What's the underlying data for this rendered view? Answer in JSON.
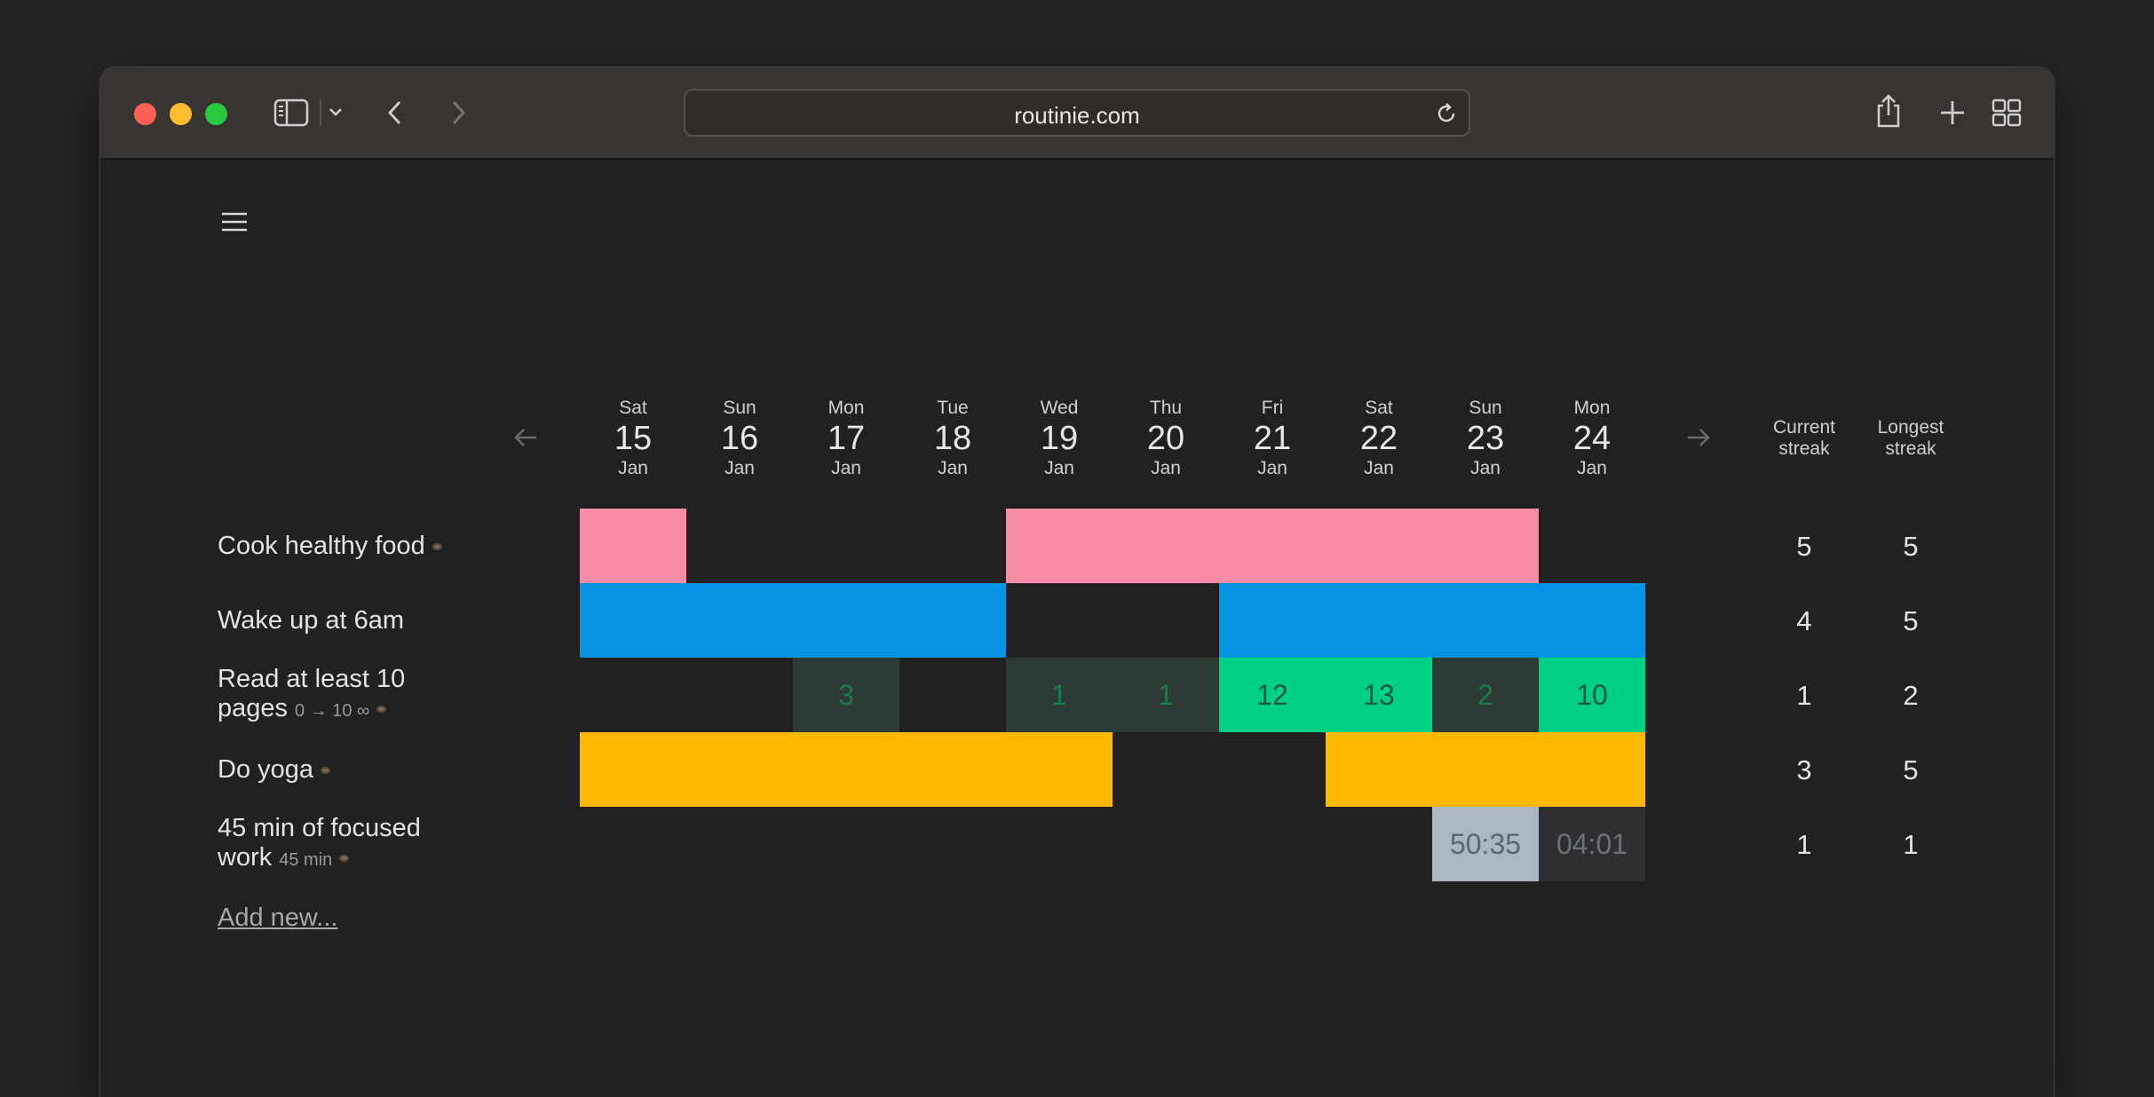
{
  "browser": {
    "url": "routinie.com"
  },
  "days": [
    {
      "dow": "Sat",
      "num": "15",
      "mon": "Jan"
    },
    {
      "dow": "Sun",
      "num": "16",
      "mon": "Jan"
    },
    {
      "dow": "Mon",
      "num": "17",
      "mon": "Jan"
    },
    {
      "dow": "Tue",
      "num": "18",
      "mon": "Jan"
    },
    {
      "dow": "Wed",
      "num": "19",
      "mon": "Jan"
    },
    {
      "dow": "Thu",
      "num": "20",
      "mon": "Jan"
    },
    {
      "dow": "Fri",
      "num": "21",
      "mon": "Jan"
    },
    {
      "dow": "Sat",
      "num": "22",
      "mon": "Jan"
    },
    {
      "dow": "Sun",
      "num": "23",
      "mon": "Jan"
    },
    {
      "dow": "Mon",
      "num": "24",
      "mon": "Jan"
    }
  ],
  "streak_headers": {
    "current": "Current streak",
    "longest": "Longest streak"
  },
  "habits": [
    {
      "name": "Cook healthy food",
      "sub": "",
      "color": "#f78ca8",
      "cells": [
        "done",
        "",
        "",
        "",
        "done",
        "done",
        "done",
        "done",
        "done",
        ""
      ],
      "current": "5",
      "longest": "5"
    },
    {
      "name": "Wake up at 6am",
      "sub": "",
      "color": "#0693e3",
      "cells": [
        "done",
        "done",
        "done",
        "done",
        "",
        "",
        "done",
        "done",
        "done",
        "done"
      ],
      "current": "4",
      "longest": "5"
    },
    {
      "name": "Read at least 10 pages",
      "sub": "0 → 10 ∞",
      "color": "#00d084",
      "cells": [
        "",
        "",
        "3",
        "",
        "1",
        "1",
        "12",
        "13",
        "2",
        "10"
      ],
      "current": "1",
      "longest": "2"
    },
    {
      "name": "Do yoga",
      "sub": "",
      "color": "#fcb900",
      "cells": [
        "done",
        "done",
        "done",
        "done",
        "done",
        "",
        "",
        "done",
        "done",
        "done"
      ],
      "current": "3",
      "longest": "5"
    },
    {
      "name": "45 min of focused work",
      "sub": "45 min",
      "color": "#abb8c3",
      "cells": [
        "",
        "",
        "",
        "",
        "",
        "",
        "",
        "",
        "50:35",
        "04:01"
      ],
      "current": "1",
      "longest": "1"
    }
  ],
  "add_new_label": "Add new..."
}
